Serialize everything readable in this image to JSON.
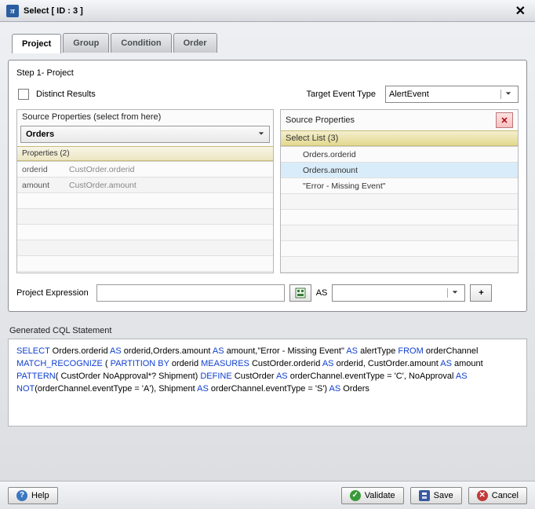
{
  "window": {
    "icon_text": "π",
    "title": "Select [ ID : 3 ]"
  },
  "tabs": {
    "items": [
      {
        "label": "Project",
        "active": true
      },
      {
        "label": "Group",
        "active": false
      },
      {
        "label": "Condition",
        "active": false
      },
      {
        "label": "Order",
        "active": false
      }
    ]
  },
  "step": {
    "title": "Step 1- Project"
  },
  "distinct": {
    "label": "Distinct Results"
  },
  "target": {
    "label": "Target Event Type",
    "value": "AlertEvent"
  },
  "sourceProps": {
    "title": "Source Properties (select from here)",
    "stream_select": "Orders",
    "props_header": "Properties (2)",
    "rows": [
      {
        "name": "orderid",
        "value": "CustOrder.orderid"
      },
      {
        "name": "amount",
        "value": "CustOrder.amount"
      }
    ]
  },
  "selectList": {
    "title": "Source Properties",
    "header": "Select List (3)",
    "items": [
      {
        "label": "Orders.orderid"
      },
      {
        "label": "Orders.amount"
      },
      {
        "label": "\"Error - Missing Event\""
      }
    ]
  },
  "projExpr": {
    "label": "Project Expression",
    "as_label": "AS"
  },
  "cql": {
    "title": "Generated CQL Statement",
    "tokens": [
      {
        "t": "SELECT",
        "k": 1
      },
      {
        "t": " Orders.orderid "
      },
      {
        "t": "AS",
        "k": 1
      },
      {
        "t": " orderid,Orders.amount "
      },
      {
        "t": "AS",
        "k": 1
      },
      {
        "t": " amount,\"Error - Missing Event\" "
      },
      {
        "t": "AS",
        "k": 1
      },
      {
        "t": " alertType "
      },
      {
        "t": "FROM",
        "k": 1
      },
      {
        "t": " orderChannel "
      },
      {
        "t": "MATCH_RECOGNIZE",
        "k": 1
      },
      {
        "t": " ( "
      },
      {
        "t": "PARTITION BY",
        "k": 1
      },
      {
        "t": " orderid "
      },
      {
        "t": "MEASURES",
        "k": 1
      },
      {
        "t": " CustOrder.orderid "
      },
      {
        "t": "AS",
        "k": 1
      },
      {
        "t": " orderid, CustOrder.amount "
      },
      {
        "t": "AS",
        "k": 1
      },
      {
        "t": " amount "
      },
      {
        "t": "PATTERN",
        "k": 1
      },
      {
        "t": "( CustOrder NoApproval*? Shipment) "
      },
      {
        "t": "DEFINE",
        "k": 1
      },
      {
        "t": " CustOrder "
      },
      {
        "t": "AS",
        "k": 1
      },
      {
        "t": " orderChannel.eventType = 'C', NoApproval "
      },
      {
        "t": "AS NOT",
        "k": 1
      },
      {
        "t": "(orderChannel.eventType = 'A'), Shipment "
      },
      {
        "t": "AS",
        "k": 1
      },
      {
        "t": " orderChannel.eventType = 'S') "
      },
      {
        "t": "AS",
        "k": 1
      },
      {
        "t": " Orders"
      }
    ]
  },
  "footer": {
    "help": "Help",
    "validate": "Validate",
    "save": "Save",
    "cancel": "Cancel"
  }
}
